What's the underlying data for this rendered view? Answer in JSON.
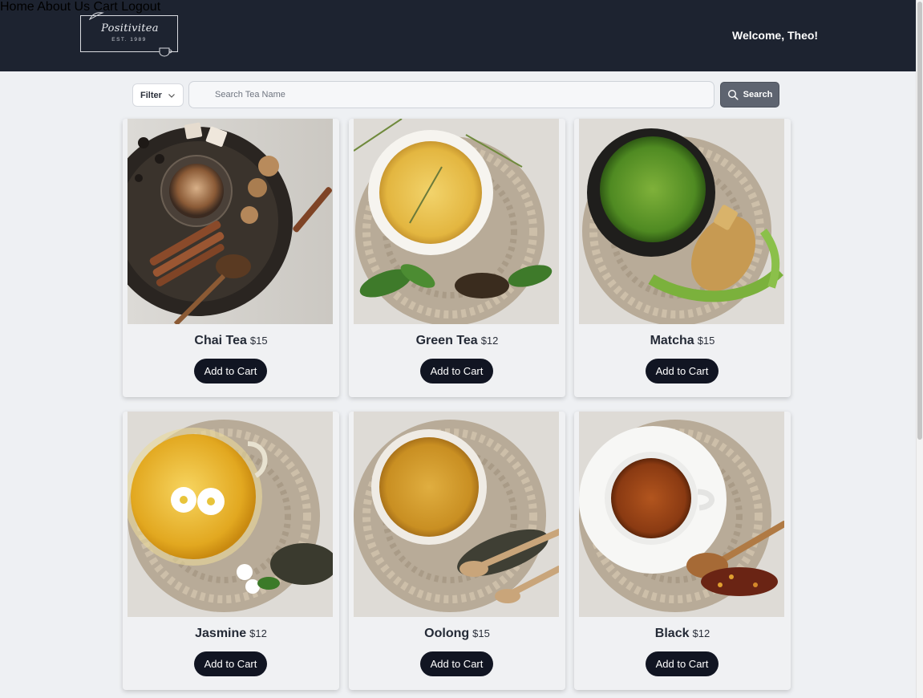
{
  "brand": {
    "logo_text": "Positivitea",
    "logo_sub": "EST. 1989"
  },
  "nav": {
    "items": [
      {
        "label": "Home"
      },
      {
        "label": "About Us"
      },
      {
        "label": "Cart"
      },
      {
        "label": "Logout"
      }
    ],
    "welcome": "Welcome, Theo!"
  },
  "search": {
    "filter_label": "Filter",
    "placeholder": "Search Tea Name",
    "value": "",
    "button_label": "Search"
  },
  "products": [
    {
      "name": "Chai Tea",
      "price": "$15",
      "button": "Add to Cart"
    },
    {
      "name": "Green Tea",
      "price": "$12",
      "button": "Add to Cart"
    },
    {
      "name": "Matcha",
      "price": "$15",
      "button": "Add to Cart"
    },
    {
      "name": "Jasmine",
      "price": "$12",
      "button": "Add to Cart"
    },
    {
      "name": "Oolong",
      "price": "$15",
      "button": "Add to Cart"
    },
    {
      "name": "Black",
      "price": "$12",
      "button": "Add to Cart"
    }
  ],
  "colors": {
    "header_bg": "#1d2330",
    "page_bg": "#eef0f3",
    "button_dark": "#111522",
    "search_button": "#5e6470"
  }
}
